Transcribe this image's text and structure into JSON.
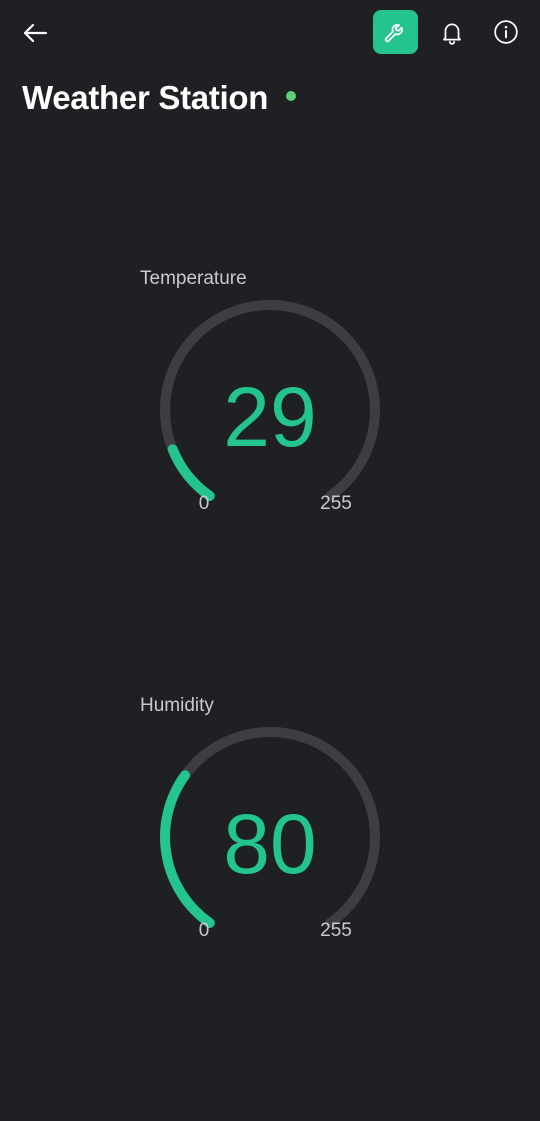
{
  "header": {
    "title": "Weather Station",
    "back_icon": "arrow-left-icon",
    "tool_icon": "wrench-icon",
    "notification_icon": "bell-icon",
    "info_icon": "info-circle-icon"
  },
  "colors": {
    "background": "#1f2023",
    "accent": "#23c48e",
    "track": "#3d3e42",
    "online_dot": "#5fcf78",
    "label": "#c9cacd"
  },
  "status": {
    "online": true
  },
  "gauges": [
    {
      "label": "Temperature",
      "value": "29",
      "min": "0",
      "max": "255"
    },
    {
      "label": "Humidity",
      "value": "80",
      "min": "0",
      "max": "255"
    }
  ]
}
